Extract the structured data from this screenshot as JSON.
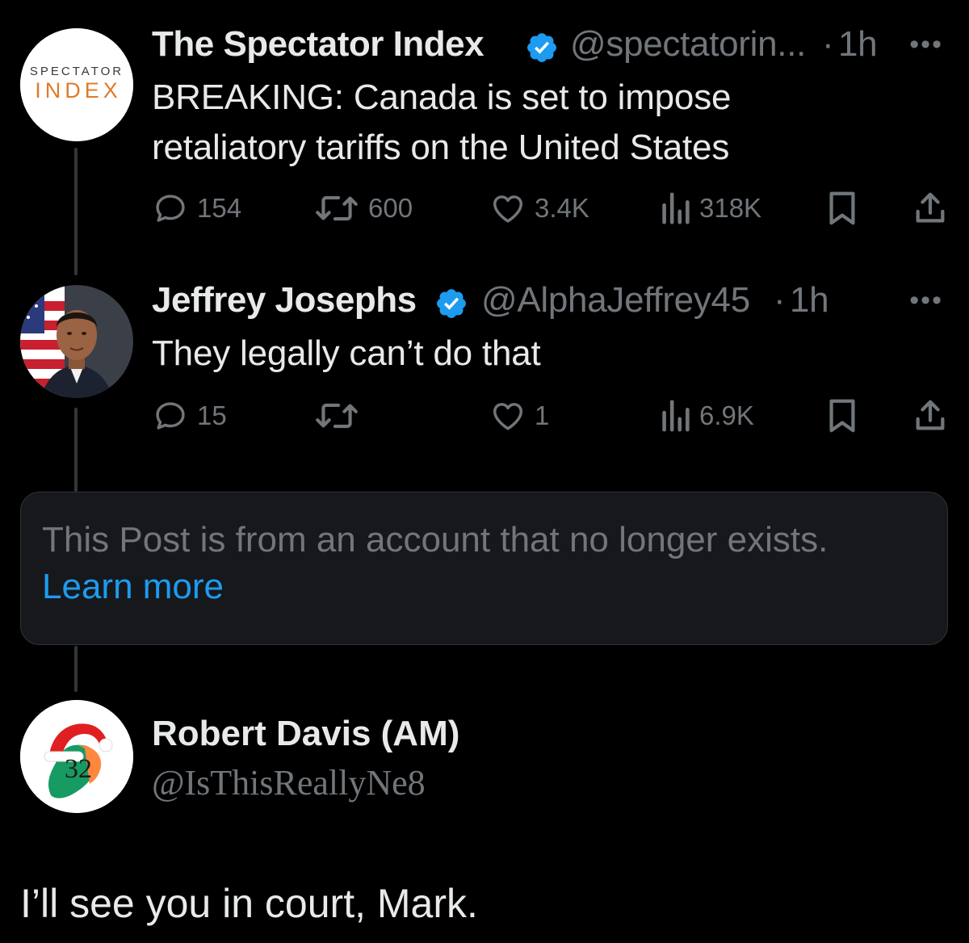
{
  "posts": [
    {
      "name": "The Spectator Index",
      "handle": "@spectatorin...",
      "separator": "·",
      "time": "1h",
      "more": "•••",
      "avatar_text_top": "SPECTATOR",
      "avatar_text_bottom": "INDEX",
      "text_line1": "BREAKING: Canada is set to impose",
      "text_line2": "retaliatory tariffs on the United States",
      "replies": "154",
      "reposts": "600",
      "likes": "3.4K",
      "views": "318K"
    },
    {
      "name": "Jeffrey Josephs",
      "handle": "@AlphaJeffrey45",
      "separator": "·",
      "time": "1h",
      "more": "•••",
      "text": "They legally can’t do that",
      "replies": "15",
      "reposts": "",
      "likes": "1",
      "views": "6.9K"
    }
  ],
  "notice": {
    "text": "This Post is from an account that no longer exists.",
    "link": "Learn more"
  },
  "main_post": {
    "name": "Robert Davis (AM)",
    "handle": "@IsThisReallyNe8",
    "avatar_number": "32",
    "text": "I’ll see you in court, Mark."
  },
  "colors": {
    "background": "#000000",
    "text": "#e7e9ea",
    "muted": "#71767b",
    "accent": "#1d9bf0",
    "thread_line": "#333639"
  },
  "icons": [
    "verified-badge-icon",
    "more-icon",
    "reply-icon",
    "repost-icon",
    "like-icon",
    "views-icon",
    "bookmark-icon",
    "share-icon"
  ]
}
